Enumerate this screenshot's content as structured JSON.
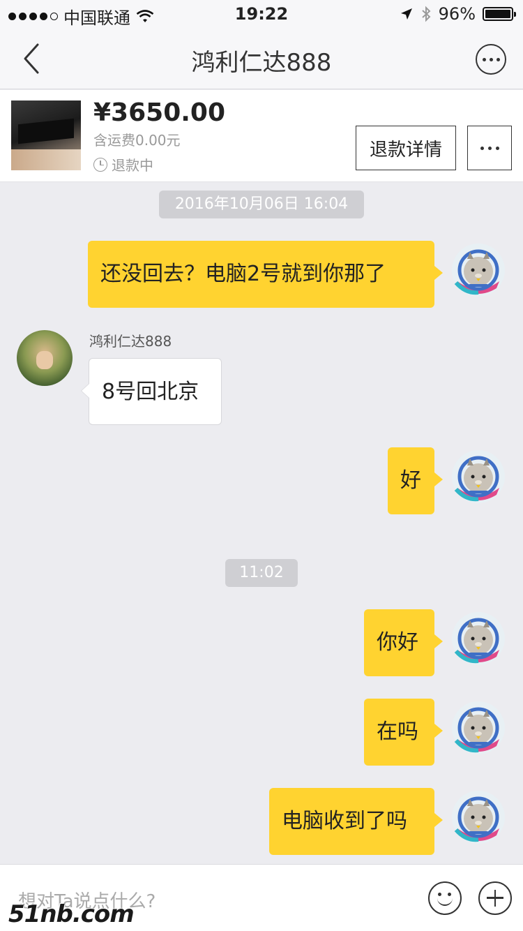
{
  "status_bar": {
    "carrier": "中国联通",
    "time": "19:22",
    "battery": "96%",
    "battery_level": 0.96,
    "icons": [
      "signal-dots",
      "wifi-icon",
      "location-arrow-icon",
      "bluetooth-icon",
      "battery-icon"
    ]
  },
  "nav": {
    "title": "鸿利仁达888",
    "back_icon": "chevron-left-icon",
    "more_icon": "more-circle-icon"
  },
  "order": {
    "price": "¥3650.00",
    "shipping": "含运费0.00元",
    "status": "退款中",
    "refund_button": "退款详情",
    "more_icon": "more-dots-icon"
  },
  "chat": {
    "timestamps": [
      "2016年10月06日 16:04",
      "11:02"
    ],
    "sender_name": "鸿利仁达888",
    "messages": [
      {
        "from": "me",
        "text": "还没回去？电脑2号就到你那了"
      },
      {
        "from": "other",
        "text": "8号回北京"
      },
      {
        "from": "me",
        "text": "好"
      },
      {
        "from": "me",
        "text": "你好"
      },
      {
        "from": "me",
        "text": "在吗"
      },
      {
        "from": "me",
        "text": "电脑收到了吗"
      }
    ]
  },
  "input_bar": {
    "placeholder": "想对Ta说点什么?",
    "emoji_icon": "smiley-icon",
    "plus_icon": "plus-circle-icon"
  },
  "watermark": "51nb.com",
  "colors": {
    "my_bubble": "#ffd330",
    "background": "#ececf0",
    "timestamp_pill": "#cfcfd3"
  }
}
